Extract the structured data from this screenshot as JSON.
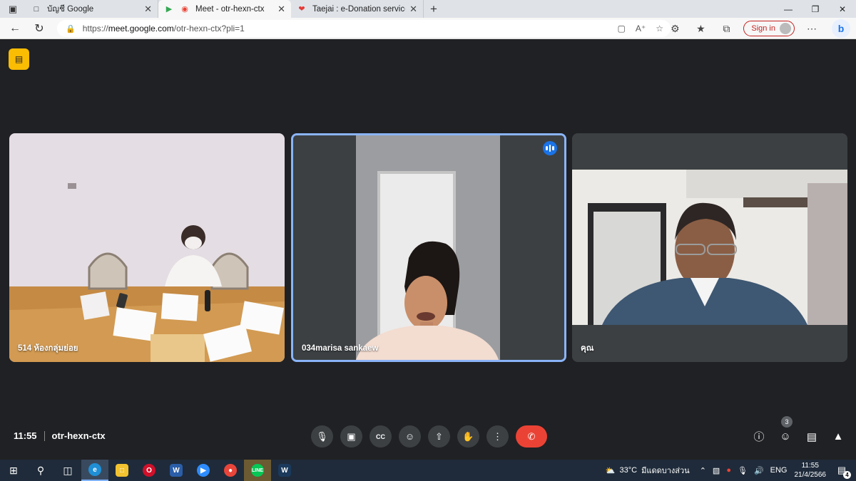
{
  "tabs": [
    {
      "title": "บัญชี Google",
      "icon": "document-icon",
      "active": false
    },
    {
      "title": "Meet - otr-hexn-ctx",
      "icon": "meet-icon",
      "active": true
    },
    {
      "title": "Taejai : e-Donation service",
      "icon": "heart-icon",
      "active": false
    }
  ],
  "address": {
    "scheme": "https://",
    "host": "meet.google.com",
    "path": "/otr-hexn-ctx?pli=1"
  },
  "browser": {
    "signin_label": "Sign in"
  },
  "participants": [
    {
      "name": "514 ห้องกลุ่มย่อย",
      "speaking": false
    },
    {
      "name": "034marisa sankaew",
      "speaking": true
    },
    {
      "name": "คุณ",
      "speaking": false
    }
  ],
  "meeting": {
    "time": "11:55",
    "code": "otr-hexn-ctx",
    "people_count": "3"
  },
  "controls": [
    "mic-icon",
    "camera-icon",
    "captions-icon",
    "emoji-icon",
    "present-icon",
    "raise-hand-icon",
    "more-icon",
    "hang-up-icon"
  ],
  "taskbar": {
    "weather": "33°C",
    "weather_text": "มีแดดบางส่วน",
    "language": "ENG",
    "clock_time": "11:55",
    "clock_date": "21/4/2566",
    "notifications": "4"
  },
  "colors": {
    "accent": "#8ab4f8",
    "hangup": "#ea4335",
    "badge": "#fbbc04"
  }
}
